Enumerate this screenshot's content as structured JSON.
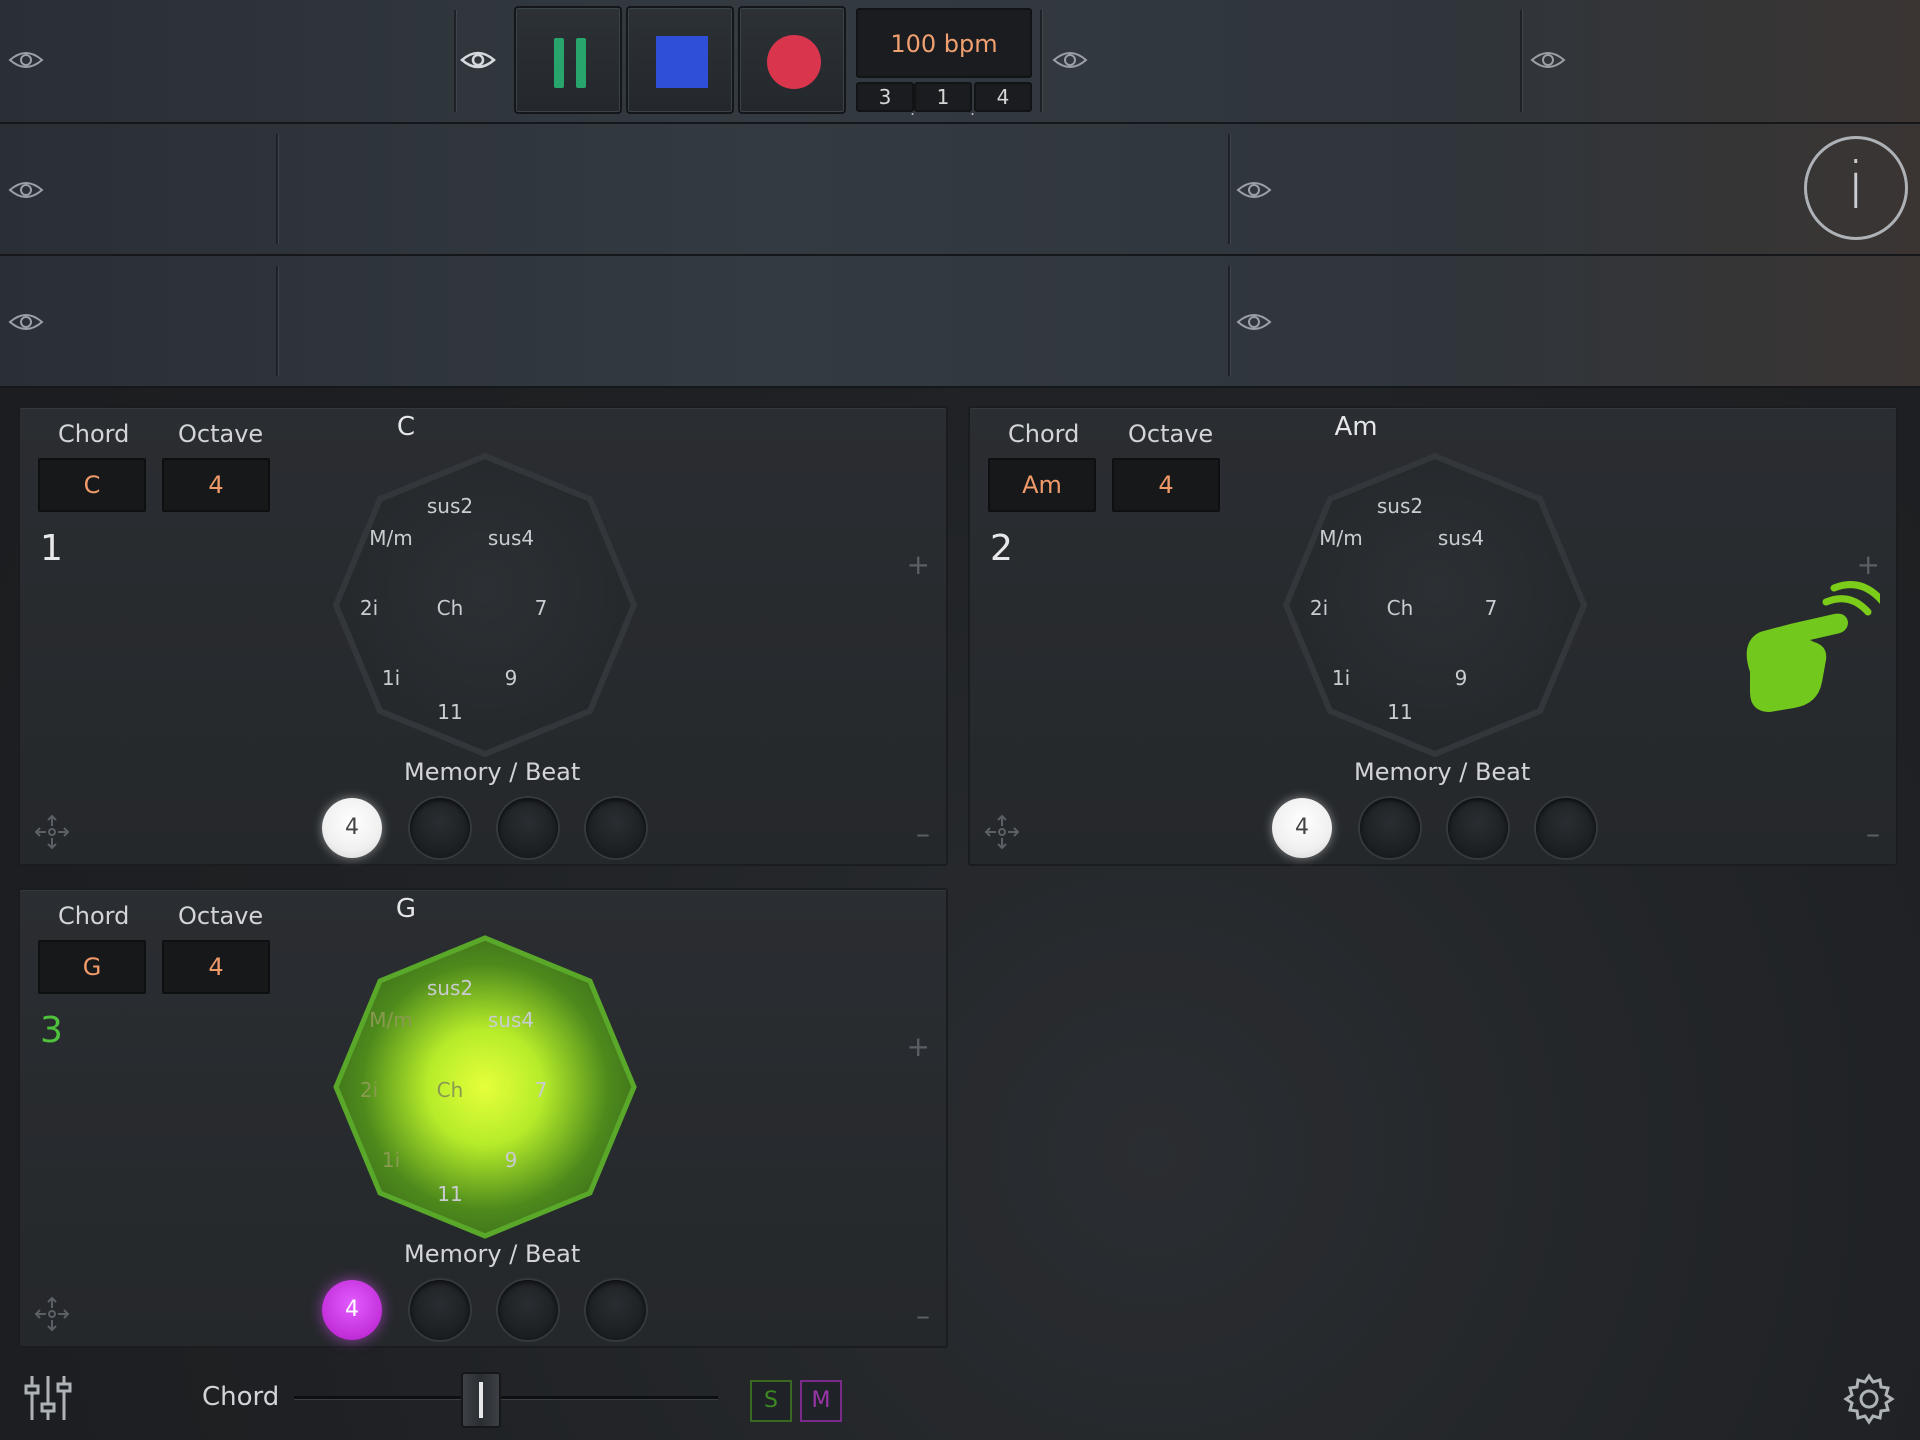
{
  "transport": {
    "tempo": "100 bpm",
    "position": {
      "bar": "3",
      "beat": "1",
      "tick": "4"
    },
    "colors": {
      "pause": "#27a56c",
      "stop": "#2f4fd8",
      "record": "#d9354d"
    }
  },
  "panels": [
    {
      "title": "C",
      "number": "1",
      "chord_label": "Chord",
      "octave_label": "Octave",
      "chord_value": "C",
      "octave_value": "4",
      "keys": {
        "top": "sus2",
        "upleft": "M/m",
        "upright": "sus4",
        "left": "2i",
        "center": "Ch",
        "right": "7",
        "lowleft": "1i",
        "lowright": "9",
        "bottom": "11"
      },
      "memory_label": "Memory / Beat",
      "memory_active": "4",
      "active": false
    },
    {
      "title": "Am",
      "number": "2",
      "chord_label": "Chord",
      "octave_label": "Octave",
      "chord_value": "Am",
      "octave_value": "4",
      "keys": {
        "top": "sus2",
        "upleft": "M/m",
        "upright": "sus4",
        "left": "2i",
        "center": "Ch",
        "right": "7",
        "lowleft": "1i",
        "lowright": "9",
        "bottom": "11"
      },
      "memory_label": "Memory / Beat",
      "memory_active": "4",
      "active": false
    },
    {
      "title": "G",
      "number": "3",
      "chord_label": "Chord",
      "octave_label": "Octave",
      "chord_value": "G",
      "octave_value": "4",
      "keys": {
        "top": "sus2",
        "upleft": "M/m",
        "upright": "sus4",
        "left": "2i",
        "center": "Ch",
        "right": "7",
        "lowleft": "1i",
        "lowright": "9",
        "bottom": "11"
      },
      "memory_label": "Memory / Beat",
      "memory_active": "4",
      "active": true
    }
  ],
  "bottom": {
    "label": "Chord",
    "slider_value": 0.44,
    "solo": "S",
    "mute": "M"
  },
  "icons": [
    "eye-icon",
    "info-icon",
    "move-icon",
    "plus-icon",
    "minus-icon",
    "mixer-icon",
    "gear-icon",
    "tap-gesture-icon"
  ],
  "accent_colors": {
    "octave_active": "#b6ec2a",
    "memory_active": "#c22fd9",
    "field_text": "#f09a6a",
    "active_number": "#4fc23c"
  }
}
